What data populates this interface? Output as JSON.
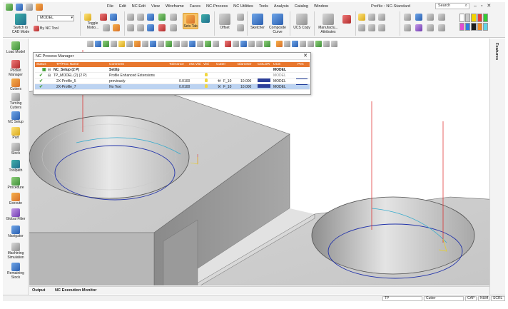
{
  "menu": {
    "items": [
      "File",
      "Edit",
      "NC Edit",
      "View",
      "Wireframe",
      "Faces",
      "NC-Process",
      "NC Utilities",
      "Tools",
      "Analysis",
      "Catalog",
      "Window"
    ],
    "title": "Profile : NC-Standard",
    "search_label": "Search"
  },
  "ribbon": {
    "switch_cad_label": "Switch to\nCAD Mode",
    "model_select_value": "MODEL",
    "by_nc_tool_label": "By NC Tool",
    "toggle_label": "Toggle\nMotio...",
    "sets_tab_label": "Sets Tab",
    "offset_label": "Offset",
    "sketcher_label": "Sketcher",
    "composite_curve_label": "Composite\nCurve",
    "ucs_copy_label": "UCS Copy",
    "manufacturing_attr_label": "Manufactu...\nAttributes",
    "palette_colors": [
      "#ffffff",
      "#c8c8c8",
      "#f2d400",
      "#e63c3c",
      "#33cc33",
      "#e34bd1",
      "#2f7de1",
      "#1c1c1c",
      "#f28d22",
      "#5fd3e8"
    ]
  },
  "left_panel": {
    "items": [
      {
        "label": "Load Model",
        "icon": "load-model-icon"
      },
      {
        "label": "Pocket\nManager",
        "icon": "pocket-manager-icon"
      },
      {
        "label": "Cutters",
        "icon": "cutters-icon"
      },
      {
        "label": "Turning\nCutters",
        "icon": "turning-cutters-icon"
      },
      {
        "label": "NC Setup",
        "icon": "nc-setup-icon"
      },
      {
        "label": "Part",
        "icon": "part-icon"
      },
      {
        "label": "Stock",
        "icon": "stock-icon"
      },
      {
        "label": "Toolpath",
        "icon": "toolpath-icon"
      },
      {
        "label": "Procedure",
        "icon": "procedure-icon"
      },
      {
        "label": "Execute",
        "icon": "execute-icon"
      },
      {
        "label": "Global Filter",
        "icon": "global-filter-icon"
      },
      {
        "label": "Navigator",
        "icon": "navigator-icon"
      },
      {
        "label": "Machining\nSimulation",
        "icon": "machining-simulation-icon"
      },
      {
        "label": "Remaining\nStock",
        "icon": "remaining-stock-icon"
      }
    ]
  },
  "features_label": "Features",
  "dialog": {
    "title": "NC Process Manager",
    "columns": [
      "Status",
      "TP/Proc Name",
      "Comment",
      "Tolerance",
      "ess Visi",
      "Visi",
      "Cutter",
      "Diameter",
      "COLOR",
      "UCS",
      "Pen"
    ],
    "rows": [
      {
        "name": "NC_Setup (2 P)",
        "comment": "SetUp",
        "tolerance": "",
        "cutter": "",
        "diameter": "",
        "ucs": "MODEL",
        "type": "setup"
      },
      {
        "name": "TP_MODEL (2) (2 P)",
        "comment": "Profile Enhanced Extensions",
        "tolerance": "",
        "cutter": "",
        "diameter": "",
        "ucs": "MODEL",
        "type": "toolpath"
      },
      {
        "name": "2X-Profile_5",
        "comment": "previously",
        "tolerance": "0.0100",
        "cutter": "F_10",
        "diameter": "10.000",
        "ucs": "MODEL",
        "type": "proc"
      },
      {
        "name": "2X-Profile_7",
        "comment": "No Text",
        "tolerance": "0.0100",
        "cutter": "F_10",
        "diameter": "10.000",
        "ucs": "MODEL",
        "type": "proc",
        "selected": true
      }
    ]
  },
  "bottom": {
    "tab_output": "Output",
    "tab_exec": "NC Execution Monitor"
  },
  "status": {
    "field1": "TP",
    "field2": "Cutter",
    "cap": "CAP",
    "num": "NUM",
    "scrl": "SCRL"
  }
}
